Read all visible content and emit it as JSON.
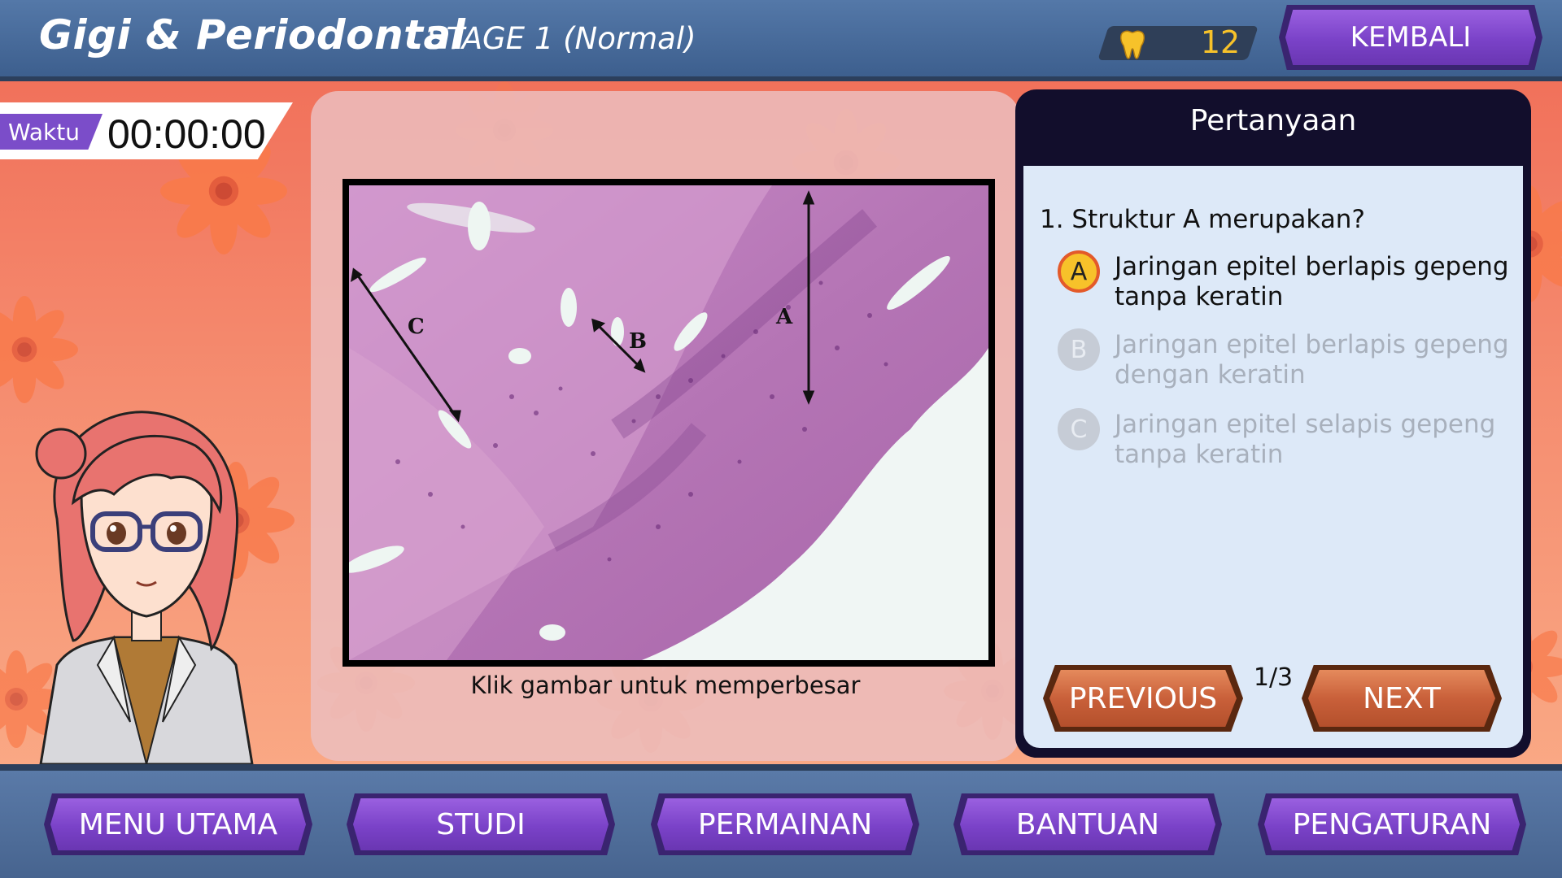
{
  "header": {
    "title": "Gigi & Periodontal",
    "stage": "STAGE 1 (Normal)",
    "score": "12",
    "back_label": "KEMBALI"
  },
  "timer": {
    "label": "Waktu",
    "value": "00:00:00"
  },
  "image_panel": {
    "caption": "Klik gambar untuk memperbesar",
    "labels": {
      "a": "A",
      "b": "B",
      "c": "C"
    }
  },
  "question_panel": {
    "header": "Pertanyaan",
    "question": "1. Struktur A merupakan?",
    "options": [
      {
        "letter": "A",
        "text": "Jaringan epitel berlapis gepeng tanpa keratin",
        "selected": true
      },
      {
        "letter": "B",
        "text": "Jaringan epitel berlapis gepeng dengan keratin",
        "selected": false
      },
      {
        "letter": "C",
        "text": "Jaringan epitel selapis gepeng tanpa keratin",
        "selected": false
      }
    ],
    "prev_label": "PREVIOUS",
    "next_label": "NEXT",
    "page_indicator": "1/3"
  },
  "bottom_nav": [
    {
      "label": "MENU UTAMA"
    },
    {
      "label": "STUDI"
    },
    {
      "label": "PERMAINAN"
    },
    {
      "label": "BANTUAN"
    },
    {
      "label": "PENGATURAN"
    }
  ],
  "colors": {
    "accent_purple": "#7a42c8",
    "score_gold": "#f7c22a",
    "button_brown": "#c9603a",
    "selected_option": "#f7c22a"
  },
  "icons": {
    "score": "tooth-icon"
  }
}
